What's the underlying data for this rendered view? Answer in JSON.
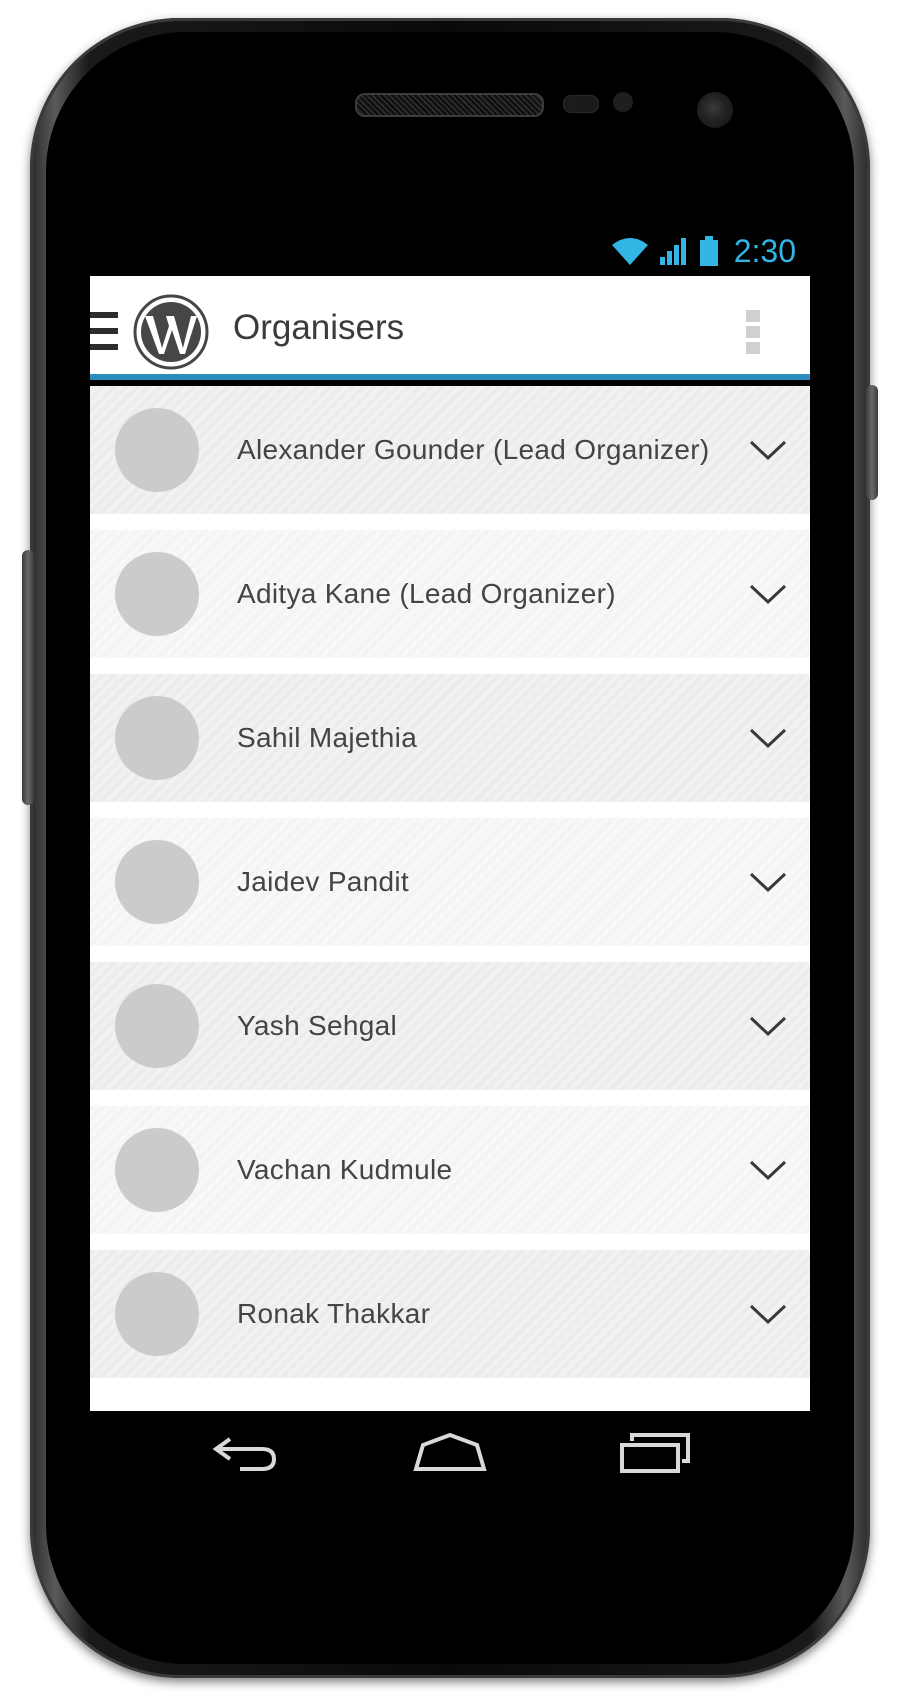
{
  "status_bar": {
    "time": "2:30",
    "icons": [
      "wifi-icon",
      "signal-icon",
      "battery-icon"
    ],
    "accent_color": "#33b5e5"
  },
  "app_bar": {
    "title": "Organisers",
    "logo": "wordpress-logo",
    "accent_color": "#2c8dbd"
  },
  "organisers": [
    {
      "name": "Alexander Gounder (Lead Organizer)"
    },
    {
      "name": "Aditya Kane (Lead Organizer)"
    },
    {
      "name": "Sahil Majethia"
    },
    {
      "name": "Jaidev Pandit"
    },
    {
      "name": "Yash Sehgal"
    },
    {
      "name": "Vachan Kudmule"
    },
    {
      "name": "Ronak Thakkar"
    }
  ],
  "nav_bar": {
    "icons": [
      "back-icon",
      "home-icon",
      "recent-apps-icon"
    ]
  }
}
